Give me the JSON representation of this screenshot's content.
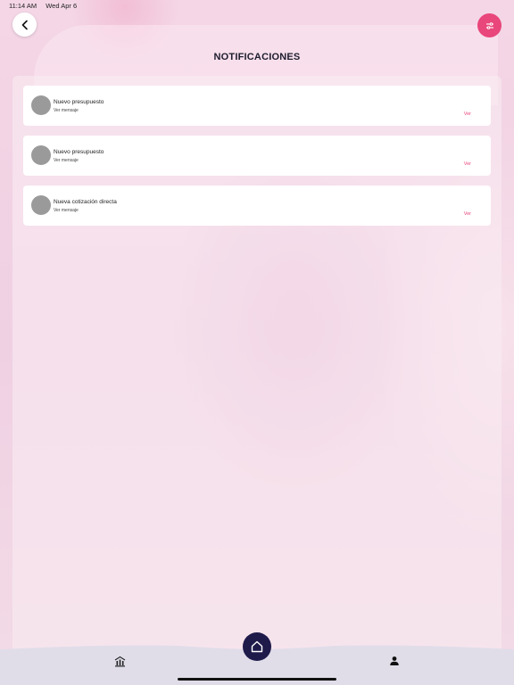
{
  "status_bar": {
    "time": "11:14 AM",
    "date": "Wed Apr 6"
  },
  "header": {
    "title": "NOTIFICACIONES",
    "back_icon": "chevron-left-icon",
    "filter_icon": "sliders-icon"
  },
  "notifications": [
    {
      "title": "Nuevo presupuesto",
      "subtitle": "Ver mensaje",
      "action": "Ver"
    },
    {
      "title": "Nuevo presupuesto",
      "subtitle": "Ver mensaje",
      "action": "Ver"
    },
    {
      "title": "Nueva cotización directa",
      "subtitle": "Ver mensaje",
      "action": "Ver"
    }
  ],
  "bottom_nav": {
    "items": [
      "stats-icon",
      "home-icon",
      "user-icon"
    ]
  },
  "colors": {
    "accent": "#e9467b",
    "home_button": "#1e1a4a",
    "nav_bar": "#e0dde9"
  }
}
